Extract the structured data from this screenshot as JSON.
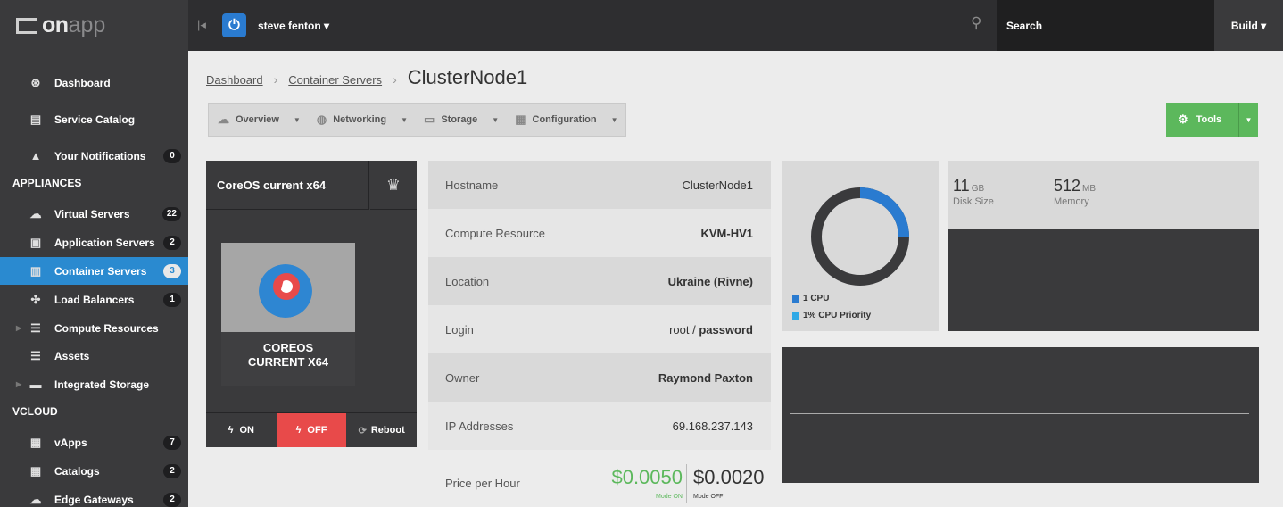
{
  "topbar": {
    "logo_on": "on",
    "logo_app": "app",
    "user": "steve fenton ▾",
    "search_placeholder": "Search",
    "build": "Build ▾"
  },
  "sidebar": {
    "items": [
      {
        "label": "Dashboard",
        "icon": "dashboard-icon",
        "glyph": "⊛"
      },
      {
        "label": "Service Catalog",
        "icon": "service-catalog-icon",
        "glyph": "▤"
      },
      {
        "label": "Your Notifications",
        "icon": "bell-icon",
        "glyph": "▲",
        "count": "0"
      }
    ],
    "appliances_heading": "APPLIANCES",
    "appliances": [
      {
        "label": "Virtual Servers",
        "icon": "cloud-icon",
        "glyph": "☁",
        "count": "22"
      },
      {
        "label": "Application Servers",
        "icon": "app-server-icon",
        "glyph": "▣",
        "count": "2"
      },
      {
        "label": "Container Servers",
        "icon": "container-icon",
        "glyph": "▥",
        "count": "3"
      },
      {
        "label": "Load Balancers",
        "icon": "load-balancer-icon",
        "glyph": "✣",
        "count": "1"
      },
      {
        "label": "Compute Resources",
        "icon": "compute-icon",
        "glyph": "☰"
      },
      {
        "label": "Assets",
        "icon": "assets-icon",
        "glyph": "☰"
      },
      {
        "label": "Integrated Storage",
        "icon": "storage-icon",
        "glyph": "▬"
      }
    ],
    "vcloud_heading": "VCLOUD",
    "vcloud": [
      {
        "label": "vApps",
        "icon": "vapps-icon",
        "glyph": "▦",
        "count": "7"
      },
      {
        "label": "Catalogs",
        "icon": "catalogs-icon",
        "glyph": "▦",
        "count": "2"
      },
      {
        "label": "Edge Gateways",
        "icon": "edge-gateway-icon",
        "glyph": "☁",
        "count": "2"
      }
    ]
  },
  "breadcrumb": {
    "home": "Dashboard",
    "parent": "Container Servers",
    "sep": "›",
    "current": "ClusterNode1"
  },
  "tabs": [
    {
      "label": "Overview",
      "icon": "cloud-icon",
      "glyph": "☁"
    },
    {
      "label": "Networking",
      "icon": "globe-icon",
      "glyph": "◍"
    },
    {
      "label": "Storage",
      "icon": "storage-icon",
      "glyph": "▭"
    },
    {
      "label": "Configuration",
      "icon": "configuration-icon",
      "glyph": "▦"
    }
  ],
  "tools": {
    "label": "Tools",
    "glyph": "⚙"
  },
  "template": {
    "title": "CoreOS current x64",
    "os_label_1": "COREOS",
    "os_label_2": "CURRENT X64",
    "on": "ON",
    "off": "OFF",
    "reboot": "Reboot"
  },
  "info": [
    {
      "key": "Hostname",
      "value": "ClusterNode1",
      "bold": false
    },
    {
      "key": "Compute Resource",
      "value": "KVM-HV1",
      "bold": true
    },
    {
      "key": "Location",
      "value": "Ukraine (Rivne)",
      "bold": true
    },
    {
      "key": "Login",
      "value": "root / ",
      "value_bold": "password",
      "bold": false
    },
    {
      "key": "Owner",
      "value": "Raymond Paxton",
      "bold": true
    },
    {
      "key": "IP Addresses",
      "value": "69.168.237.143",
      "bold": false
    }
  ],
  "price": {
    "label": "Price per Hour",
    "on_value": "$0.0050",
    "on_mode": "Mode ON",
    "off_value": "$0.0020",
    "off_mode": "Mode OFF"
  },
  "cpu": {
    "cpus": "1 CPU",
    "priority": "1% CPU Priority",
    "cpu_usage_fraction": 0.25,
    "colors": {
      "cpu": "#2a7bd0",
      "priority": "#2fa9e6",
      "ring": "#3a3a3c"
    }
  },
  "disk": {
    "value": "11",
    "unit": "GB",
    "label": "Disk Size"
  },
  "memory": {
    "value": "512",
    "unit": "MB",
    "label": "Memory"
  }
}
